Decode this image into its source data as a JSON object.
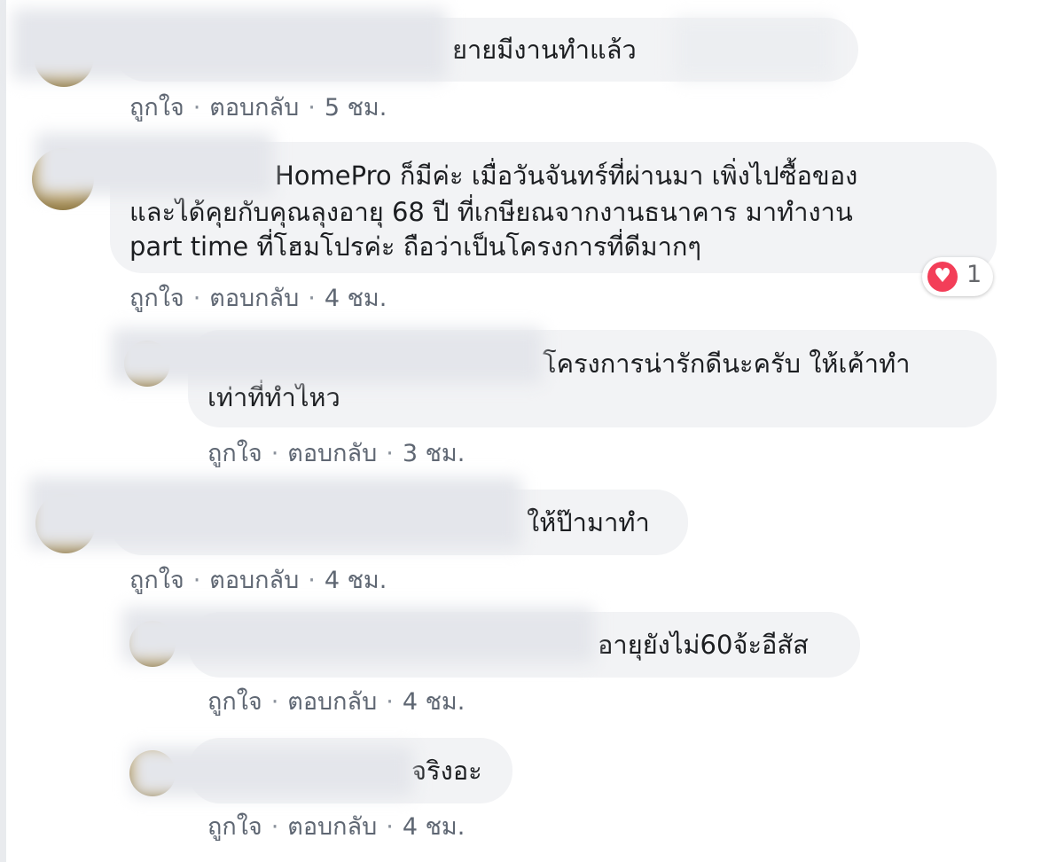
{
  "like_label": "ถูกใจ",
  "reply_label": "ตอบกลับ",
  "separator": "·",
  "comments": [
    {
      "lines": [
        "ยายมีงานทำแล้ว"
      ],
      "time": "5 ชม."
    },
    {
      "lines": [
        "HomePro ก็มีค่ะ เมื่อวันจันทร์ที่ผ่านมา เพิ่งไปซื้อของ",
        "และได้คุยกับคุณลุงอายุ 68 ปี ที่เกษียณจากงานธนาคาร มาทำงาน",
        "part time ที่โฮมโปรค่ะ ถือว่าเป็นโครงการที่ดีมากๆ"
      ],
      "time": "4 ชม.",
      "reaction": {
        "icon": "heart-icon",
        "count": "1"
      }
    },
    {
      "lines": [
        "โครงการน่ารักดีนะครับ ให้เค้าทำ",
        "เท่าที่ทำไหว"
      ],
      "time": "3 ชม."
    },
    {
      "lines": [
        "ให้ป๊ามาทำ"
      ],
      "time": "4 ชม."
    },
    {
      "lines": [
        "อายุยังไม่60จ้ะอีสัส"
      ],
      "time": "4 ชม."
    },
    {
      "lines": [
        "จริงอะ"
      ],
      "time": "4 ชม."
    }
  ],
  "colors": {
    "bubble": "#f2f3f5",
    "meta_text": "#5f6773",
    "reaction_heart": "#f33e58"
  }
}
